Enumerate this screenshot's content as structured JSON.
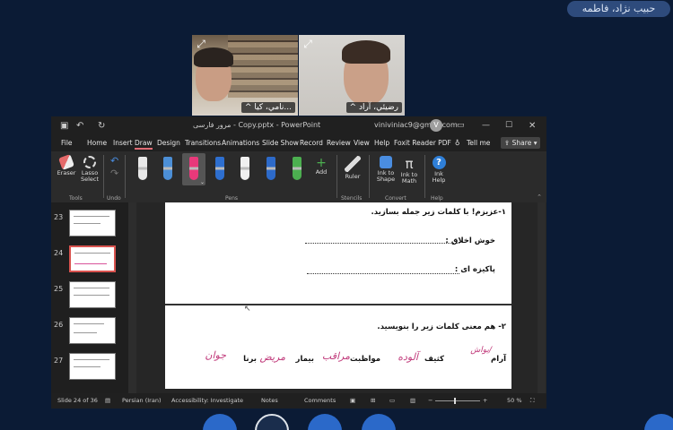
{
  "meeting": {
    "name_chip": "حبيب نژاد، فاطمه",
    "video1_label": "^ نامي، كيا...",
    "video2_label": "^ رضيئي، آراد"
  },
  "window": {
    "title": "مرور فارسی - Copy.pptx - PowerPoint",
    "account": "viniviniac9@gmail.com",
    "account_initial": "V"
  },
  "menu": {
    "items": [
      "File",
      "Home",
      "Insert",
      "Draw",
      "Design",
      "Transitions",
      "Animations",
      "Slide Show",
      "Record",
      "Review",
      "View",
      "Help",
      "Foxit Reader PDF"
    ],
    "active": "Draw",
    "tell_me": "Tell me",
    "share": "Share"
  },
  "ribbon": {
    "eraser": "Eraser",
    "lasso": "Lasso Select",
    "tools_label": "Tools",
    "undo_label": "Undo",
    "pens_label": "Pens",
    "add": "Add",
    "ruler": "Ruler",
    "stencils_label": "Stencils",
    "ink_to_shape": "Ink to Shape",
    "ink_to_math": "Ink to Math",
    "convert_label": "Convert",
    "ink_help": "Ink Help",
    "help_label": "Help",
    "pen_colors": [
      "#e8e8e8",
      "#4c8fd6",
      "#e8397a",
      "#2e6fcf",
      "#f0f0f0",
      "#2d6ac9",
      "#4caf50"
    ]
  },
  "thumbnails": [
    {
      "num": "23"
    },
    {
      "num": "24"
    },
    {
      "num": "25"
    },
    {
      "num": "26"
    },
    {
      "num": "27"
    }
  ],
  "slide": {
    "q1": "۱-عزیزم! با کلمات زیر جمله بسازید.",
    "w1": "خوش اخلاق :",
    "w2": "پاکیزه ای :",
    "q2": "۲- هم معنی کلمات زیر را بنویسید.",
    "words": [
      "آرام",
      "کثیف",
      "مواظبت",
      "بیمار",
      "برنا"
    ],
    "ink": [
      "یواش/",
      "آلوده",
      "مراقب",
      "مریض",
      "جوان"
    ]
  },
  "status": {
    "slide_info": "Slide 24 of 36",
    "language": "Persian (Iran)",
    "accessibility": "Accessibility: Investigate",
    "notes": "Notes",
    "comments": "Comments",
    "zoom": "50 %"
  }
}
